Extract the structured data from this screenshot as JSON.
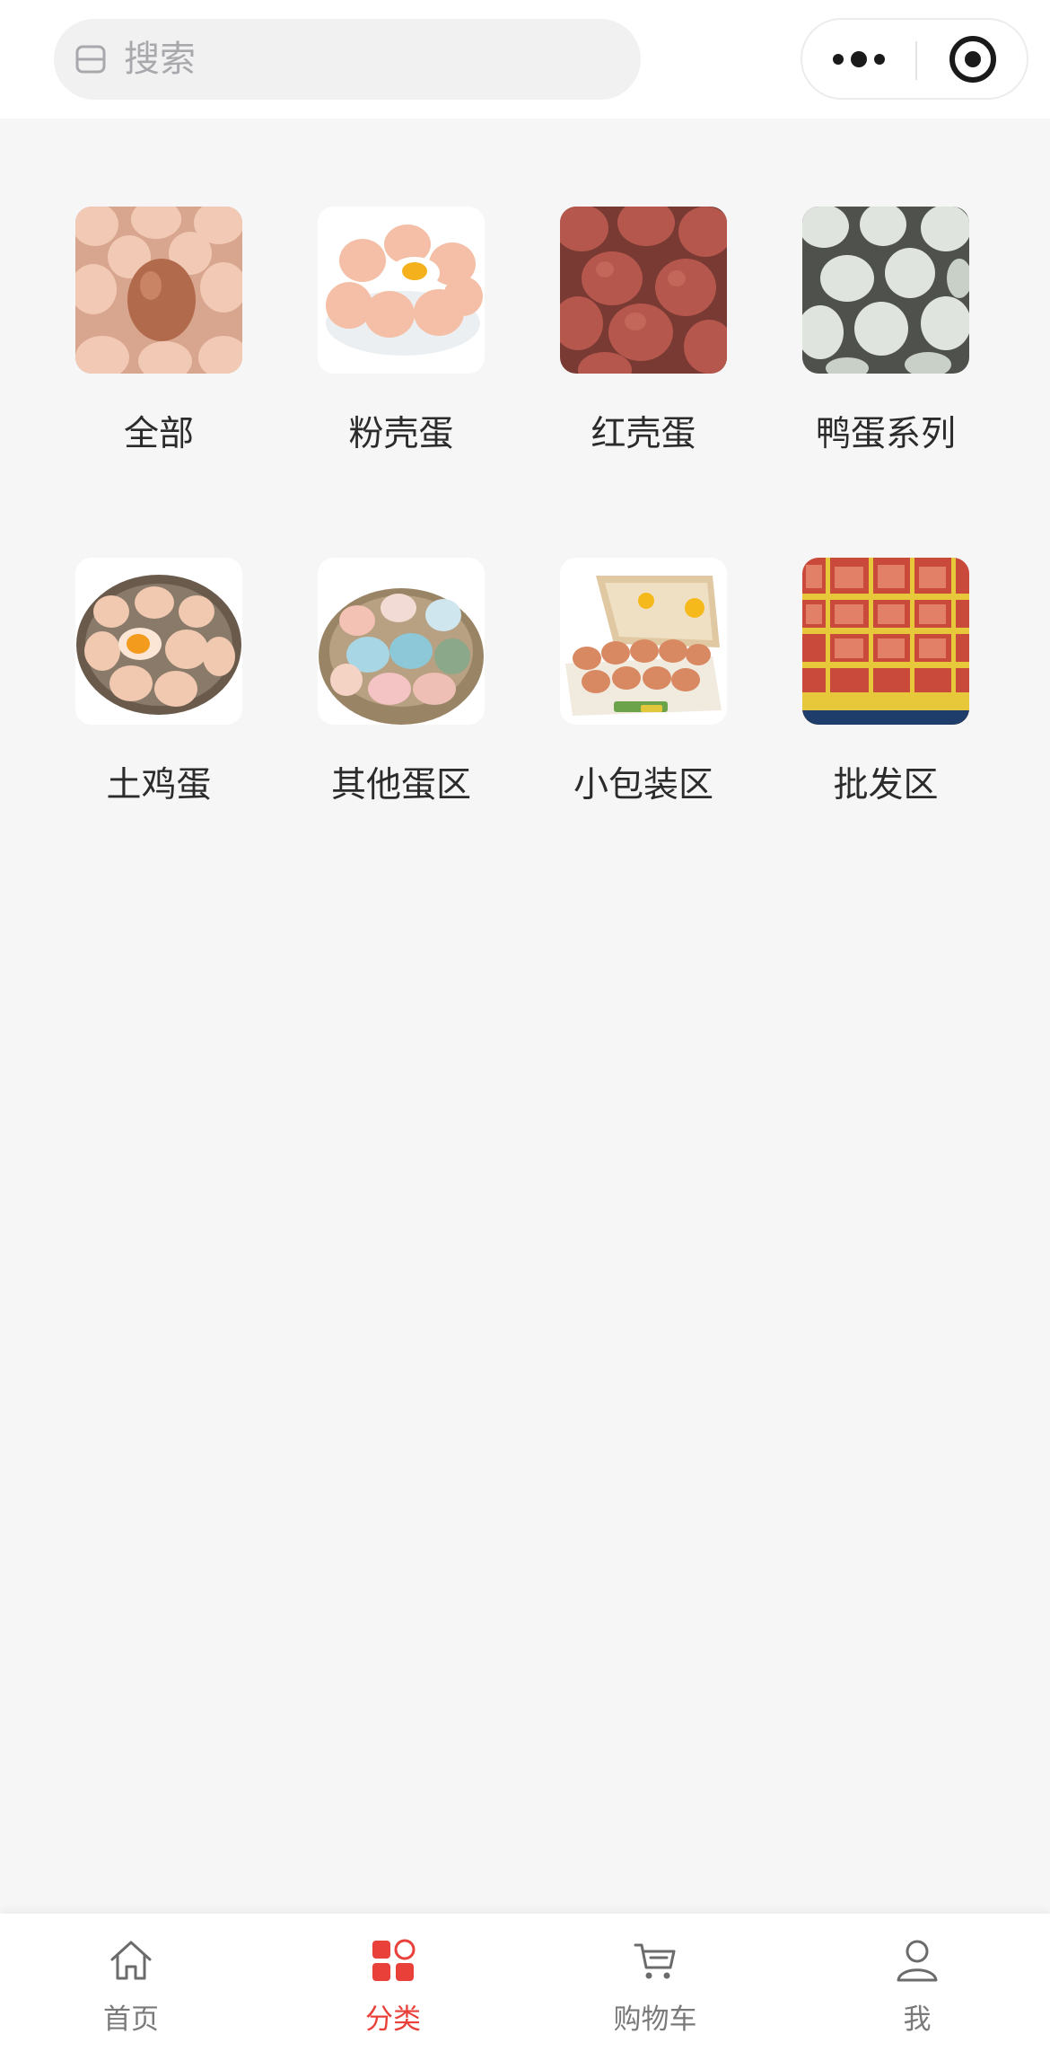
{
  "search": {
    "placeholder": "搜索"
  },
  "capsule": {
    "menu_icon": "more-dots-icon",
    "close_icon": "target-close-icon"
  },
  "categories": [
    {
      "label": "全部",
      "image": "egg-tray-brown-photo"
    },
    {
      "label": "粉壳蛋",
      "image": "pink-eggs-bowl-photo"
    },
    {
      "label": "红壳蛋",
      "image": "red-eggs-photo"
    },
    {
      "label": "鸭蛋系列",
      "image": "duck-eggs-photo"
    },
    {
      "label": "土鸡蛋",
      "image": "basket-eggs-photo"
    },
    {
      "label": "其他蛋区",
      "image": "colored-eggs-basket-photo"
    },
    {
      "label": "小包装区",
      "image": "egg-carton-photo"
    },
    {
      "label": "批发区",
      "image": "wholesale-egg-trays-photo"
    }
  ],
  "tabbar": {
    "accent_color": "#e9403a",
    "inactive_color": "#7a7a7a",
    "items": [
      {
        "label": "首页",
        "icon": "home-icon",
        "active": false
      },
      {
        "label": "分类",
        "icon": "category-icon",
        "active": true
      },
      {
        "label": "购物车",
        "icon": "cart-icon",
        "active": false
      },
      {
        "label": "我",
        "icon": "user-icon",
        "active": false
      }
    ]
  }
}
